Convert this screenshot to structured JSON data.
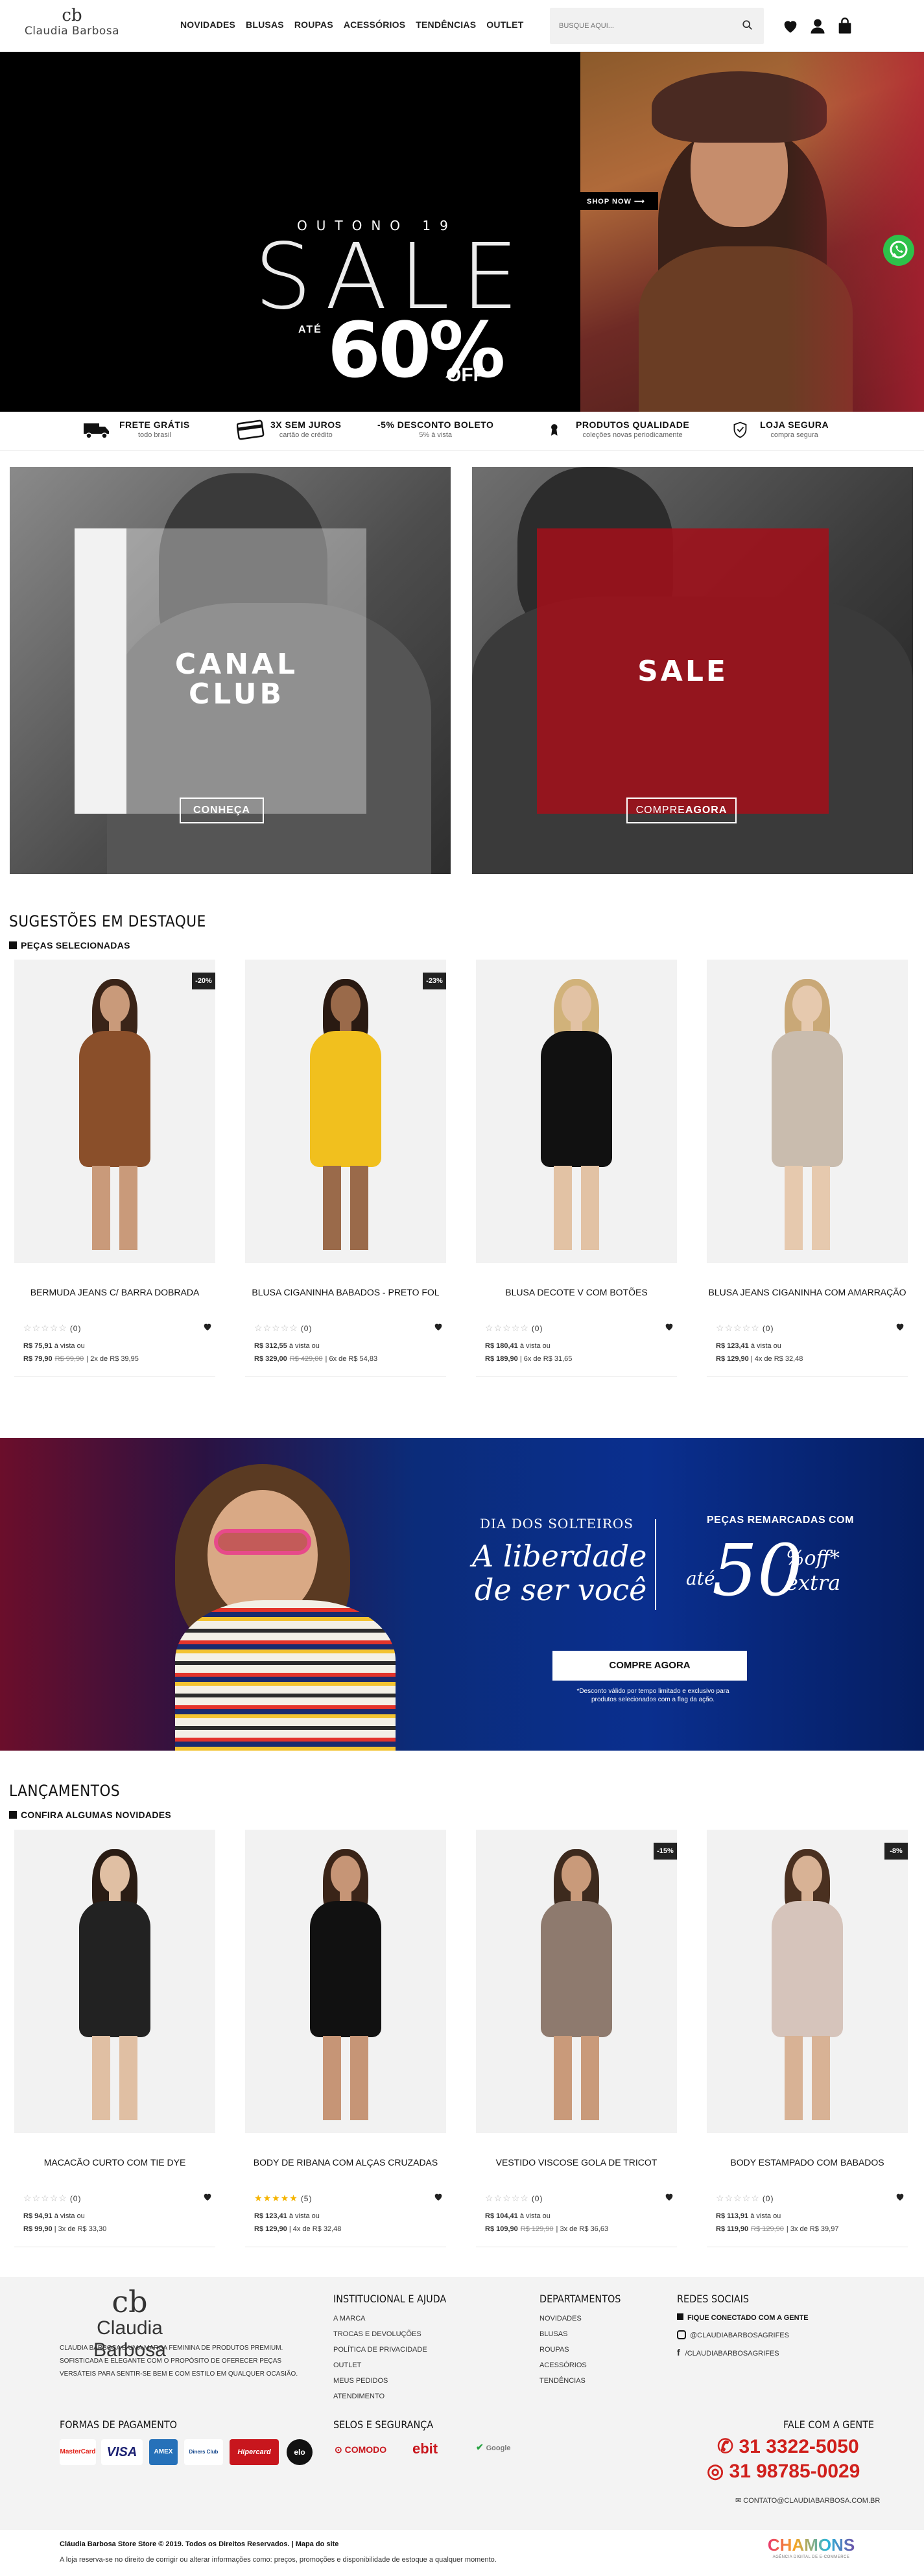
{
  "brand": {
    "monogram": "cb",
    "name": "Claudia Barbosa"
  },
  "nav": [
    "NOVIDADES",
    "BLUSAS",
    "ROUPAS",
    "ACESSÓRIOS",
    "TENDÊNCIAS",
    "OUTLET"
  ],
  "search": {
    "placeholder": "BUSQUE AQUI..."
  },
  "hero": {
    "season": "OUTONO 19",
    "headline": "SALE",
    "prefix": "ATÉ",
    "percent": "60%",
    "suffix": "OFF",
    "cta": "SHOP NOW"
  },
  "benefits": [
    {
      "title": "FRETE GRÁTIS",
      "sub": "todo brasil"
    },
    {
      "title": "3X SEM JUROS",
      "sub": "cartão de crédito"
    },
    {
      "title": "-5% DESCONTO BOLETO",
      "sub": "5% à vista"
    },
    {
      "title": "PRODUTOS QUALIDADE",
      "sub": "coleções novas periodicamente"
    },
    {
      "title": "LOJA SEGURA",
      "sub": "compra segura"
    }
  ],
  "promos": [
    {
      "title1": "CANAL",
      "title2": "CLUB",
      "cta": "CONHEÇA"
    },
    {
      "title1": "SALE",
      "cta_a": "COMPRE",
      "cta_b": "AGORA"
    }
  ],
  "featured": {
    "title": "SUGESTÕES EM DESTAQUE",
    "subtitle": "PEÇAS SELECIONADAS",
    "products": [
      {
        "name": "BERMUDA JEANS C/ BARRA DOBRADA",
        "badge": "-20%",
        "reviews": "(0)",
        "cash": "R$ 75,91",
        "cash_label": "à vista ou",
        "price": "R$ 79,90",
        "old": "R$ 99,90",
        "inst": "2x de R$ 39,95",
        "rating": 0
      },
      {
        "name": "BLUSA CIGANINHA BABADOS - PRETO FOL",
        "badge": "-23%",
        "reviews": "(0)",
        "cash": "R$ 312,55",
        "cash_label": "à vista ou",
        "price": "R$ 329,00",
        "old": "R$ 429,00",
        "inst": "6x de R$ 54,83",
        "rating": 0
      },
      {
        "name": "BLUSA DECOTE V COM BOTÕES",
        "badge": "",
        "reviews": "(0)",
        "cash": "R$ 180,41",
        "cash_label": "à vista ou",
        "price": "R$ 189,90",
        "old": "",
        "inst": "6x de R$ 31,65",
        "rating": 0
      },
      {
        "name": "BLUSA JEANS CIGANINHA COM AMARRAÇÃO",
        "badge": "",
        "reviews": "(0)",
        "cash": "R$ 123,41",
        "cash_label": "à vista ou",
        "price": "R$ 129,90",
        "old": "",
        "inst": "4x de R$ 32,48",
        "rating": 0
      }
    ]
  },
  "solteiros": {
    "kicker": "DIA DOS SOLTEIROS",
    "line1": "A liberdade",
    "line2": "de ser você",
    "right_top": "PEÇAS REMARCADAS COM",
    "ate": "até",
    "big": "50",
    "pct_off": "%off*",
    "extra": "extra",
    "cta": "COMPRE AGORA",
    "note1": "*Desconto válido por tempo limitado e exclusivo para",
    "note2": "produtos selecionados com a flag da ação."
  },
  "launches": {
    "title": "LANÇAMENTOS",
    "subtitle": "CONFIRA ALGUMAS NOVIDADES",
    "products": [
      {
        "name": "MACACÃO CURTO COM TIE DYE",
        "badge": "",
        "reviews": "(0)",
        "cash": "R$ 94,91",
        "cash_label": "à vista ou",
        "price": "R$ 99,90",
        "old": "",
        "inst": "3x de R$ 33,30",
        "rating": 0
      },
      {
        "name": "BODY DE RIBANA COM ALÇAS CRUZADAS",
        "badge": "",
        "reviews": "(5)",
        "cash": "R$ 123,41",
        "cash_label": "à vista ou",
        "price": "R$ 129,90",
        "old": "",
        "inst": "4x de R$ 32,48",
        "rating": 5
      },
      {
        "name": "VESTIDO VISCOSE GOLA DE TRICOT",
        "badge": "-15%",
        "reviews": "(0)",
        "cash": "R$ 104,41",
        "cash_label": "à vista ou",
        "price": "R$ 109,90",
        "old": "R$ 129,90",
        "inst": "3x de R$ 36,63",
        "rating": 0
      },
      {
        "name": "BODY ESTAMPADO COM BABADOS",
        "badge": "-8%",
        "reviews": "(0)",
        "cash": "R$ 113,91",
        "cash_label": "à vista ou",
        "price": "R$ 119,90",
        "old": "R$ 129,90",
        "inst": "3x de R$ 39,97",
        "rating": 0
      }
    ]
  },
  "footer": {
    "about": "CLAUDIA BARBOSA É UMA MARCA FEMININA DE PRODUTOS PREMIUM. SOFISTICADA E ELEGANTE COM O PROPÓSITO DE OFERECER PEÇAS VERSÁTEIS PARA SENTIR-SE BEM E COM ESTILO EM QUALQUER OCASIÃO.",
    "inst_title": "INSTITUCIONAL E AJUDA",
    "inst": [
      "A MARCA",
      "TROCAS E DEVOLUÇÕES",
      "POLÍTICA DE PRIVACIDADE",
      "OUTLET",
      "MEUS PEDIDOS",
      "ATENDIMENTO"
    ],
    "dept_title": "DEPARTAMENTOS",
    "dept": [
      "NOVIDADES",
      "BLUSAS",
      "ROUPAS",
      "ACESSÓRIOS",
      "TENDÊNCIAS"
    ],
    "social_title": "REDES SOCIAIS",
    "social_sub": "FIQUE CONECTADO COM A GENTE",
    "instagram": "@CLAUDIABARBOSAGRIFES",
    "facebook": "/CLAUDIABARBOSAGRIFES",
    "pay_title": "FORMAS DE PAGAMENTO",
    "pay": [
      "MasterCard",
      "VISA",
      "AMEX",
      "Diners Club",
      "Hipercard",
      "elo"
    ],
    "sec_title": "SELOS E SEGURANÇA",
    "seals": [
      "COMODO",
      "ebit",
      "Google"
    ],
    "contact_title": "FALE COM A GENTE",
    "phone": "31 3322-5050",
    "whatsapp": "31 98785-0029",
    "email": "CONTATO@CLAUDIABARBOSA.COM.BR",
    "copyright": "Cláudia Barbosa Store Store © 2019. Todos os Direitos Reservados. | Mapa do site",
    "disclaimer": "A loja reserva-se no direito de corrigir ou alterar informações como: preços, promoções e disponibilidade de estoque a qualquer momento.",
    "agency": "CHAMONS",
    "agency_sub": "AGÊNCIA DIGITAL DE E-COMMERCE"
  },
  "colors": {
    "accent": "#111111",
    "sale_red": "#a0101a",
    "whatsapp": "#2ec14a",
    "star": "#f5b400",
    "phone_red": "#d0201c"
  }
}
